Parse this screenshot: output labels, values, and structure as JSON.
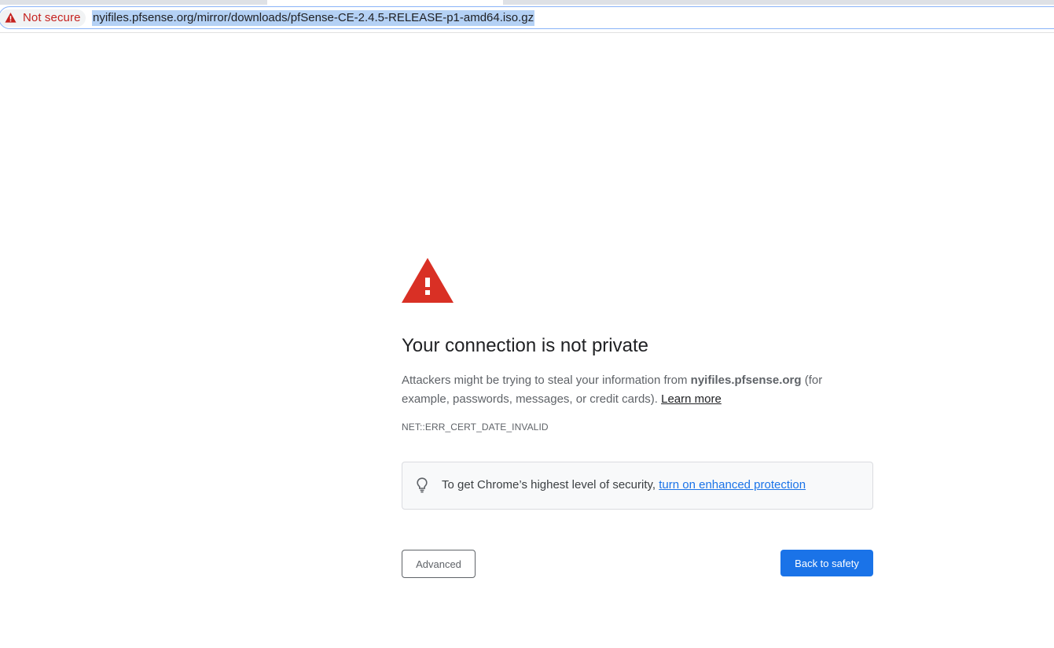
{
  "browser": {
    "security_chip": {
      "label": "Not secure",
      "icon": "warning-triangle-icon",
      "color": "#c5221f"
    },
    "url": "nyifiles.pfsense.org/mirror/downloads/pfSense-CE-2.4.5-RELEASE-p1-amd64.iso.gz"
  },
  "interstitial": {
    "icon": "warning-triangle-icon",
    "heading": "Your connection is not private",
    "explain": {
      "part1": "Attackers might be trying to steal your information from ",
      "host": "nyifiles.pfsense.org",
      "part2": " (for example, passwords, messages, or credit cards). ",
      "learn_more": "Learn more"
    },
    "error_code": "NET::ERR_CERT_DATE_INVALID",
    "promo": {
      "icon": "lightbulb-icon",
      "text": "To get Chrome’s highest level of security, ",
      "link": "turn on enhanced protection"
    },
    "buttons": {
      "advanced": "Advanced",
      "back_to_safety": "Back to safety"
    }
  },
  "colors": {
    "primary_button": "#1a73e8",
    "warning_red": "#d93025",
    "link": "#1a73e8"
  }
}
